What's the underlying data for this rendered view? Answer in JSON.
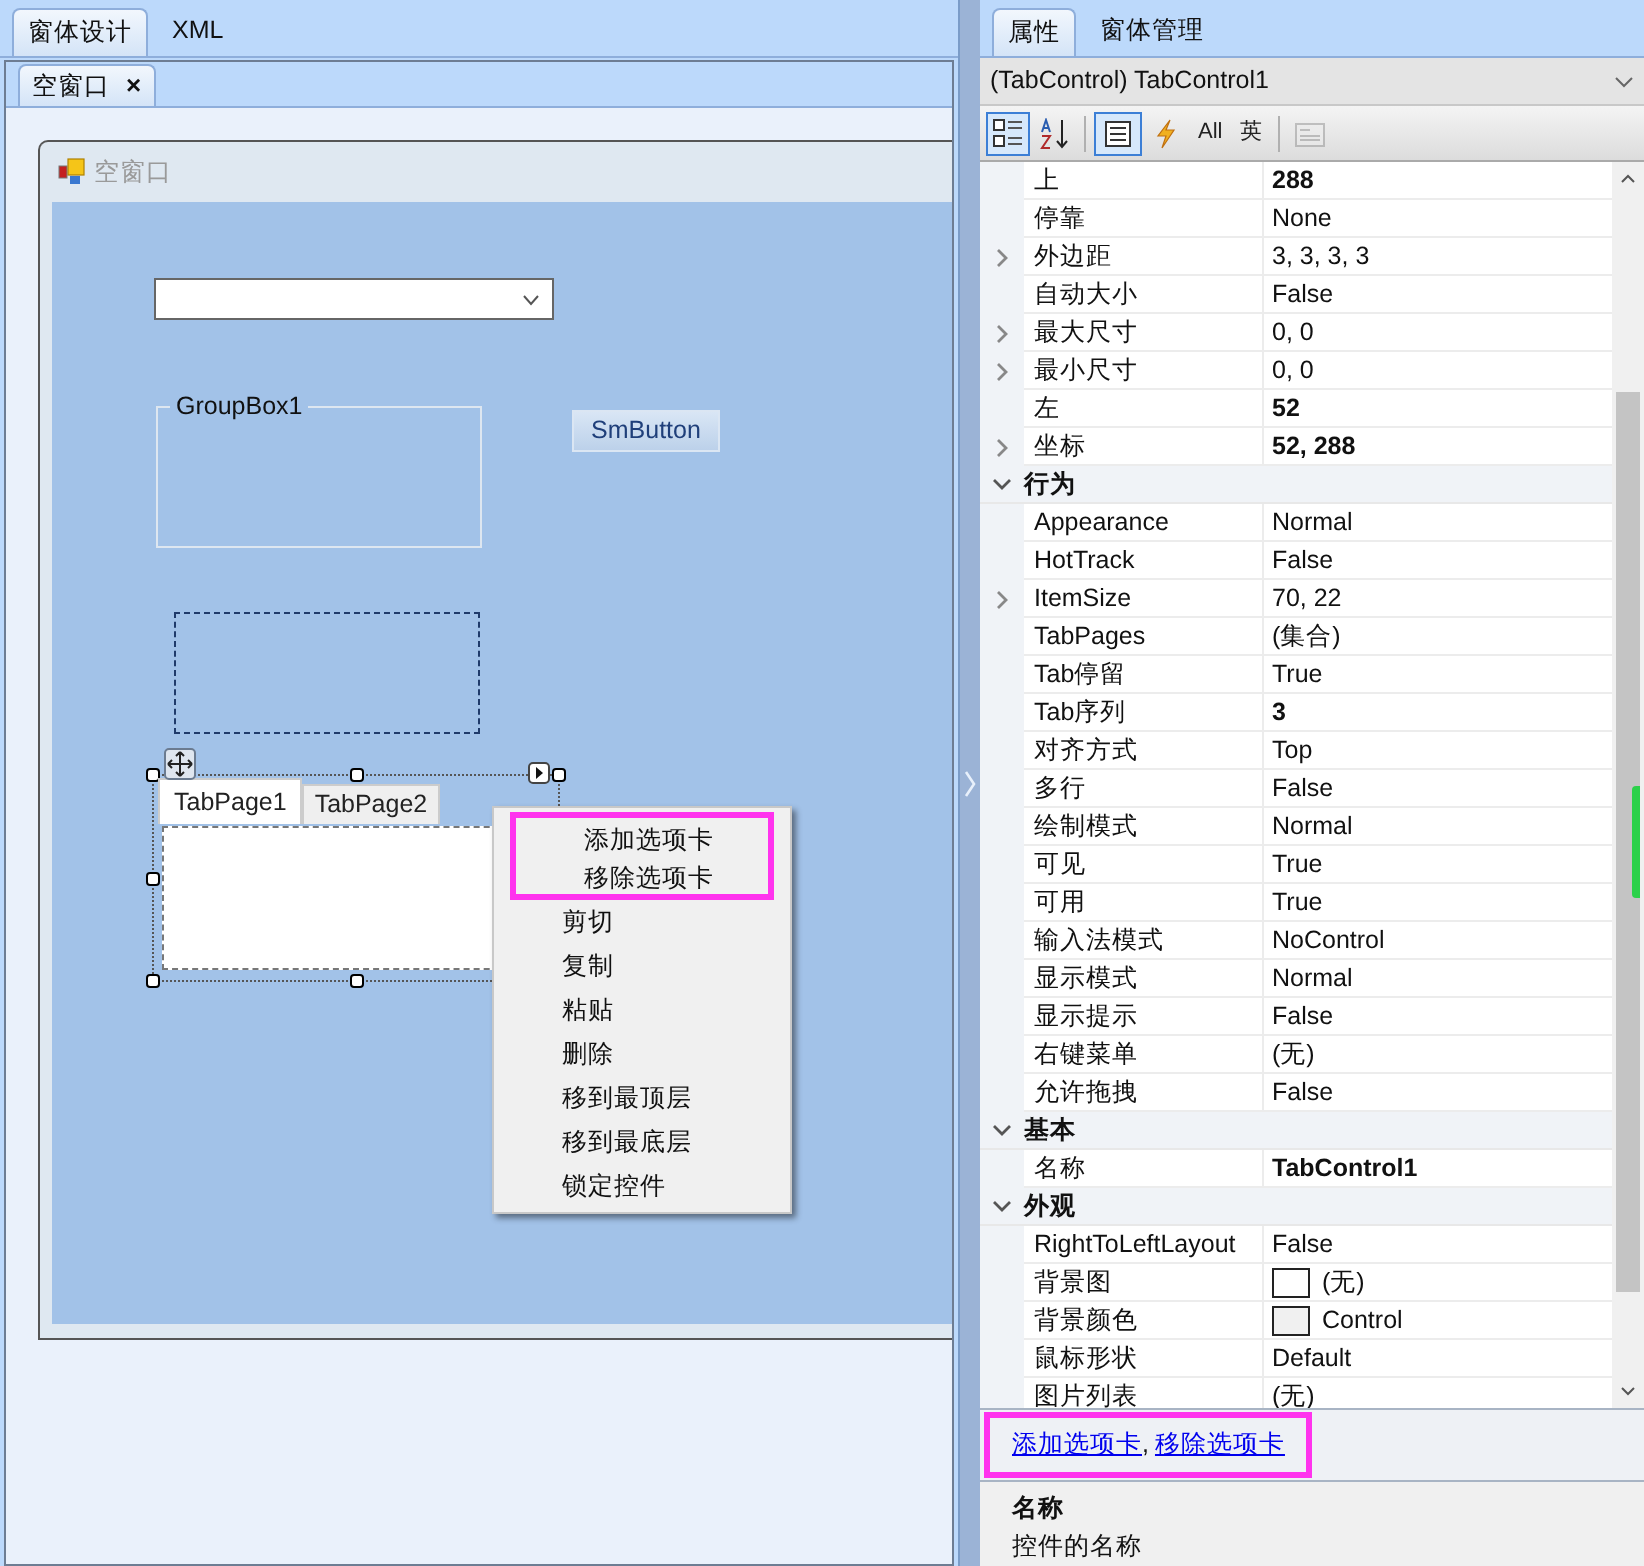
{
  "designer_tabs": [
    {
      "label": "窗体设计",
      "selected": true
    },
    {
      "label": "XML",
      "selected": false
    }
  ],
  "document_tabs": [
    {
      "label": "空窗口",
      "close": "×",
      "selected": true
    }
  ],
  "form": {
    "title": "空窗口",
    "controls": [
      {
        "kind": "combobox"
      },
      {
        "kind": "groupbox",
        "label": "GroupBox1"
      },
      {
        "kind": "button",
        "label": "SmButton"
      },
      {
        "kind": "panel"
      },
      {
        "kind": "tabcontrol",
        "tabs": [
          {
            "label": "TabPage1",
            "selected": true
          },
          {
            "label": "TabPage2",
            "selected": false
          }
        ]
      }
    ]
  },
  "context_menu": [
    {
      "label": "添加选项卡",
      "highlighted": true
    },
    {
      "label": "移除选项卡",
      "highlighted": true
    },
    {
      "label": "剪切",
      "highlighted": false
    },
    {
      "label": "复制",
      "highlighted": false
    },
    {
      "label": "粘贴",
      "highlighted": false
    },
    {
      "label": "删除",
      "highlighted": false
    },
    {
      "label": "移到最顶层",
      "highlighted": false
    },
    {
      "label": "移到最底层",
      "highlighted": false
    },
    {
      "label": "锁定控件",
      "highlighted": false
    }
  ],
  "panel_tabs": [
    {
      "label": "属性",
      "selected": true
    },
    {
      "label": "窗体管理",
      "selected": false
    }
  ],
  "object_selector": {
    "value": "(TabControl) TabControl1"
  },
  "toolbar": [
    {
      "kind": "categorized",
      "selected": true
    },
    {
      "kind": "alphabetical",
      "selected": false
    },
    {
      "kind": "separator"
    },
    {
      "kind": "properties",
      "selected": true
    },
    {
      "kind": "events",
      "selected": false
    },
    {
      "kind": "text",
      "label": "All",
      "selected": false
    },
    {
      "kind": "text",
      "label": "英",
      "selected": false
    },
    {
      "kind": "separator"
    },
    {
      "kind": "pages",
      "selected": false,
      "disabled": true
    }
  ],
  "properties": [
    {
      "kind": "property",
      "name": "上",
      "value": "288",
      "bold": true,
      "expandable": false
    },
    {
      "kind": "property",
      "name": "停靠",
      "value": "None",
      "bold": false,
      "expandable": false
    },
    {
      "kind": "property",
      "name": "外边距",
      "value": "3, 3, 3, 3",
      "bold": false,
      "expandable": true
    },
    {
      "kind": "property",
      "name": "自动大小",
      "value": "False",
      "bold": false,
      "expandable": false
    },
    {
      "kind": "property",
      "name": "最大尺寸",
      "value": "0, 0",
      "bold": false,
      "expandable": true
    },
    {
      "kind": "property",
      "name": "最小尺寸",
      "value": "0, 0",
      "bold": false,
      "expandable": true
    },
    {
      "kind": "property",
      "name": "左",
      "value": "52",
      "bold": true,
      "expandable": false
    },
    {
      "kind": "property",
      "name": "坐标",
      "value": "52, 288",
      "bold": true,
      "expandable": true
    },
    {
      "kind": "category",
      "name": "行为",
      "expanded": true
    },
    {
      "kind": "property",
      "name": "Appearance",
      "value": "Normal",
      "bold": false,
      "expandable": false
    },
    {
      "kind": "property",
      "name": "HotTrack",
      "value": "False",
      "bold": false,
      "expandable": false
    },
    {
      "kind": "property",
      "name": "ItemSize",
      "value": "70, 22",
      "bold": false,
      "expandable": true
    },
    {
      "kind": "property",
      "name": "TabPages",
      "value": "(集合)",
      "bold": false,
      "expandable": false
    },
    {
      "kind": "property",
      "name": "Tab停留",
      "value": "True",
      "bold": false,
      "expandable": false
    },
    {
      "kind": "property",
      "name": "Tab序列",
      "value": "3",
      "bold": true,
      "expandable": false
    },
    {
      "kind": "property",
      "name": "对齐方式",
      "value": "Top",
      "bold": false,
      "expandable": false
    },
    {
      "kind": "property",
      "name": "多行",
      "value": "False",
      "bold": false,
      "expandable": false
    },
    {
      "kind": "property",
      "name": "绘制模式",
      "value": "Normal",
      "bold": false,
      "expandable": false
    },
    {
      "kind": "property",
      "name": "可见",
      "value": "True",
      "bold": false,
      "expandable": false
    },
    {
      "kind": "property",
      "name": "可用",
      "value": "True",
      "bold": false,
      "expandable": false
    },
    {
      "kind": "property",
      "name": "输入法模式",
      "value": "NoControl",
      "bold": false,
      "expandable": false
    },
    {
      "kind": "property",
      "name": "显示模式",
      "value": "Normal",
      "bold": false,
      "expandable": false
    },
    {
      "kind": "property",
      "name": "显示提示",
      "value": "False",
      "bold": false,
      "expandable": false
    },
    {
      "kind": "property",
      "name": "右键菜单",
      "value": "(无)",
      "bold": false,
      "expandable": false
    },
    {
      "kind": "property",
      "name": "允许拖拽",
      "value": "False",
      "bold": false,
      "expandable": false
    },
    {
      "kind": "category",
      "name": "基本",
      "expanded": true
    },
    {
      "kind": "property",
      "name": "名称",
      "value": "TabControl1",
      "bold": true,
      "expandable": false
    },
    {
      "kind": "category",
      "name": "外观",
      "expanded": true
    },
    {
      "kind": "property",
      "name": "RightToLeftLayout",
      "value": "False",
      "bold": false,
      "expandable": false
    },
    {
      "kind": "property",
      "name": "背景图",
      "value": "(无)",
      "bold": false,
      "expandable": false,
      "color": "#ffffff"
    },
    {
      "kind": "property",
      "name": "背景颜色",
      "value": "Control",
      "bold": false,
      "expandable": false,
      "color": "#f0f0f0"
    },
    {
      "kind": "property",
      "name": "鼠标形状",
      "value": "Default",
      "bold": false,
      "expandable": false
    },
    {
      "kind": "property",
      "name": "图片列表",
      "value": "(无)",
      "bold": false,
      "expandable": false
    }
  ],
  "commands": {
    "highlighted": true,
    "links": [
      "添加选项卡",
      "移除选项卡"
    ],
    "separator": ","
  },
  "description": {
    "title": "名称",
    "text": "控件的名称"
  }
}
